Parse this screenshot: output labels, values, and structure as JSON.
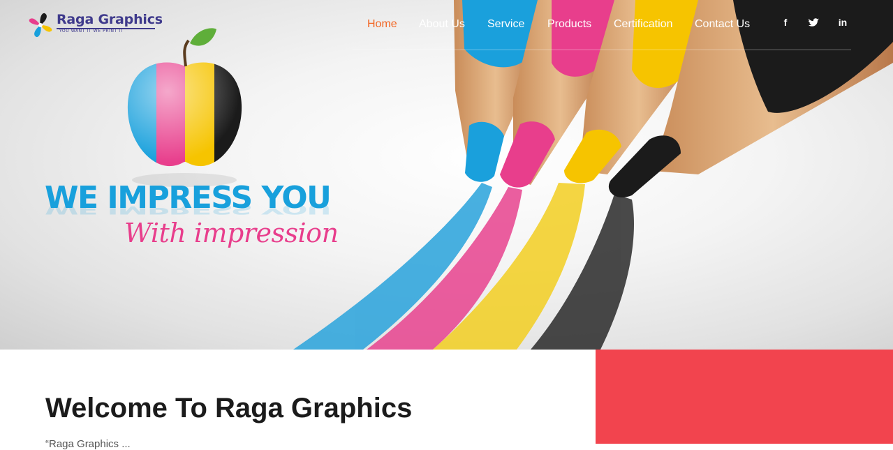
{
  "brand": {
    "name": "Raga Graphics",
    "tagline": "YOU WANT IT WE PRINT IT",
    "mark_colors": [
      "#e83e8c",
      "#18a0dc",
      "#f6c400",
      "#1b1b1b"
    ]
  },
  "nav": {
    "items": [
      {
        "label": "Home",
        "active": true
      },
      {
        "label": "About Us",
        "active": false
      },
      {
        "label": "Service",
        "active": false
      },
      {
        "label": "Products",
        "active": false
      },
      {
        "label": "Certification",
        "active": false
      },
      {
        "label": "Contact Us",
        "active": false
      }
    ],
    "active_color": "#f26522"
  },
  "social": {
    "facebook": "f",
    "twitter": "twitter-icon",
    "linkedin": "in"
  },
  "hero": {
    "headline": "WE IMPRESS YOU",
    "subline": "With impression",
    "headline_color": "#18a0dc",
    "subline_color": "#e83e8c",
    "pencil_colors": [
      "#1aa0dc",
      "#e83e8c",
      "#f6c400",
      "#1b1b1b"
    ]
  },
  "welcome": {
    "title": "Welcome To Raga Graphics",
    "text": "“Raga Graphics ..."
  },
  "accent_color": "#f2444e"
}
